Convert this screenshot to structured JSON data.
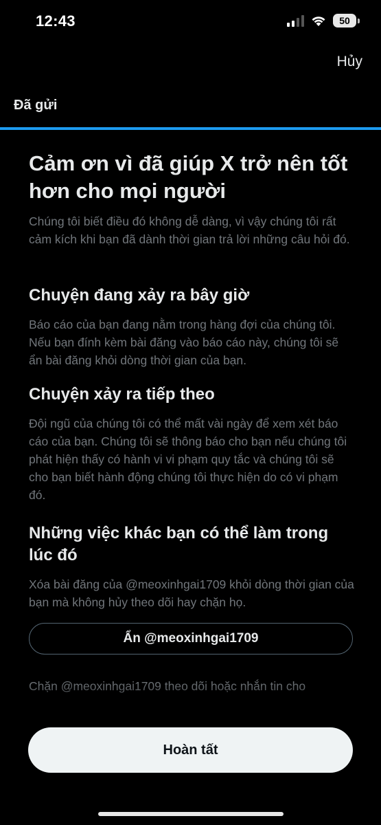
{
  "status_bar": {
    "time": "12:43",
    "battery": "50",
    "icons": [
      "cellular-signal-icon",
      "wifi-icon",
      "battery-icon"
    ]
  },
  "header": {
    "cancel_label": "Hủy",
    "step_label": "Đã gửi",
    "progress_fraction": 1.0,
    "accent_color": "#1d9bf0"
  },
  "main": {
    "title": "Cảm ơn vì đã giúp X trở nên tốt hơn cho mọi người",
    "description": "Chúng tôi biết điều đó không dễ dàng, vì vậy chúng tôi rất cảm kích khi bạn đã dành thời gian trả lời những câu hỏi đó.",
    "sections": [
      {
        "title": "Chuyện đang xảy ra bây giờ",
        "text": "Báo cáo của bạn đang nằm trong hàng đợi của chúng tôi. Nếu bạn đính kèm bài đăng vào báo cáo này, chúng tôi sẽ ẩn bài đăng khỏi dòng thời gian của bạn."
      },
      {
        "title": "Chuyện xảy ra tiếp theo",
        "text": "Đội ngũ của chúng tôi có thể mất vài ngày để xem xét báo cáo của bạn. Chúng tôi sẽ thông báo cho bạn nếu chúng tôi phát hiện thấy có hành vi vi phạm quy tắc và chúng tôi sẽ cho bạn biết hành động chúng tôi thực hiện do có vi phạm đó."
      },
      {
        "title": "Những việc khác bạn có thể làm trong lúc đó",
        "text": "Xóa bài đăng của @meoxinhgai1709 khỏi dòng thời gian của bạn mà không hủy theo dõi hay chặn họ.",
        "button_label": "Ẩn @meoxinhgai1709",
        "extra_text": "Chặn @meoxinhgai1709 theo dõi hoặc nhắn tin cho"
      }
    ]
  },
  "footer": {
    "done_label": "Hoàn tất"
  }
}
